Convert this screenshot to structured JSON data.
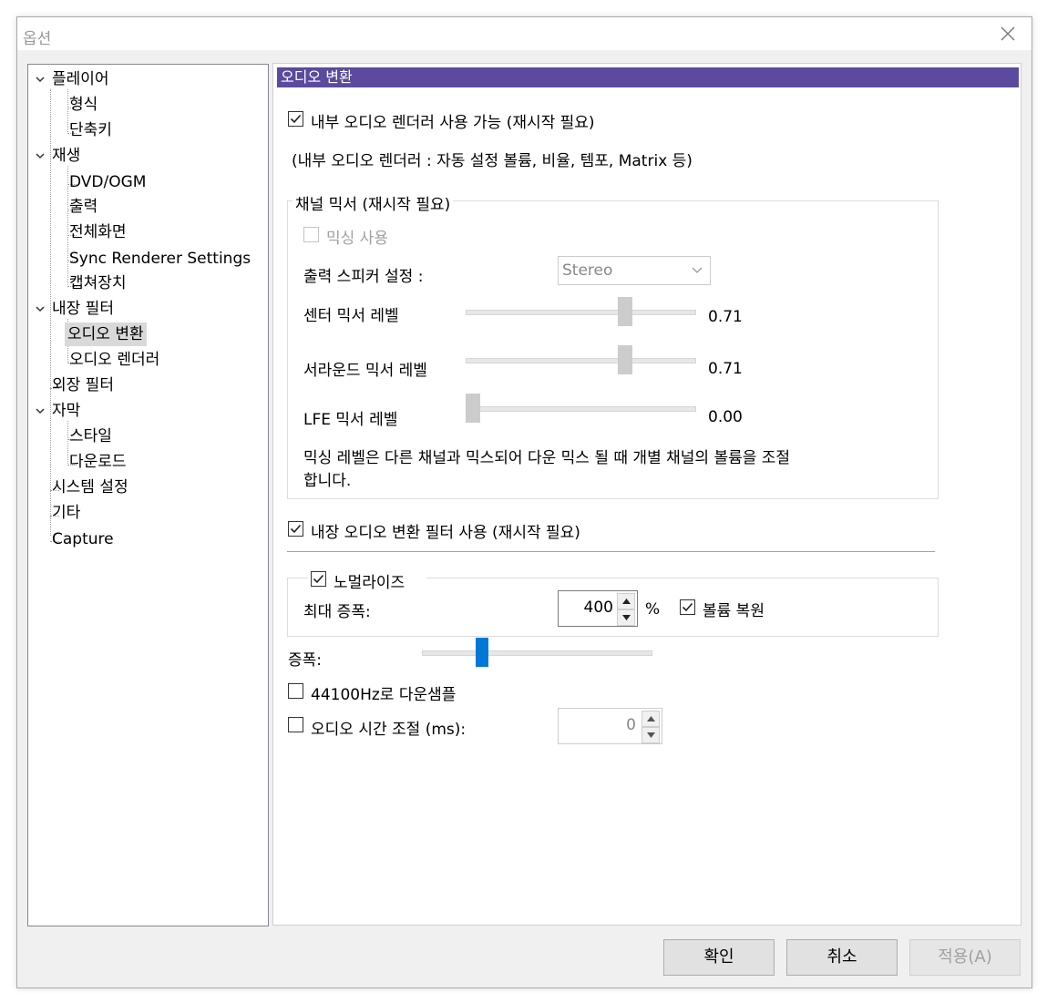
{
  "window": {
    "title": "옵션"
  },
  "tree": {
    "items": [
      {
        "label": "플레이어"
      },
      {
        "label": "형식"
      },
      {
        "label": "단축키"
      },
      {
        "label": "재생"
      },
      {
        "label": "DVD/OGM"
      },
      {
        "label": "출력"
      },
      {
        "label": "전체화면"
      },
      {
        "label": "Sync Renderer Settings"
      },
      {
        "label": "캡쳐장치"
      },
      {
        "label": "내장 필터"
      },
      {
        "label": "오디오 변환"
      },
      {
        "label": "오디오 렌더러"
      },
      {
        "label": "외장 필터"
      },
      {
        "label": "자막"
      },
      {
        "label": "스타일"
      },
      {
        "label": "다운로드"
      },
      {
        "label": "시스템 설정"
      },
      {
        "label": "기타"
      },
      {
        "label": "Capture"
      }
    ],
    "selected": "오디오 변환"
  },
  "panel": {
    "header": "오디오 변환",
    "internal_renderer": {
      "label": "내부 오디오 렌더러 사용 가능 (재시작 필요)",
      "checked": true
    },
    "internal_renderer_note": "(내부 오디오 렌더러 : 자동 설정 볼륨, 비율, 템포, Matrix 등)",
    "channel_mixer": {
      "title": "채널 믹서 (재시작 필요)",
      "enable_mixing": {
        "label": "믹싱 사용",
        "checked": false,
        "disabled": true
      },
      "speaker_label": "출력 스피커 설정 :",
      "speaker_value": "Stereo",
      "center_label": "센터 믹서 레벨",
      "center_value": "0.71",
      "center_level": 0.71,
      "surround_label": "서라운드 믹서 레벨",
      "surround_value": "0.71",
      "surround_level": 0.71,
      "lfe_label": "LFE 믹서 레벨",
      "lfe_value": "0.00",
      "lfe_level": 0.0,
      "note_line1": "믹싱 레벨은 다른 채널과 믹스되어 다운 믹스 될 때 개별 채널의 볼륨을 조절",
      "note_line2": "합니다."
    },
    "builtin_filter": {
      "label": "내장 오디오 변환 필터 사용 (재시작 필요)",
      "checked": true
    },
    "normalize": {
      "label": "노멀라이즈",
      "checked": true,
      "max_amp_label": "최대 증폭:",
      "max_amp_value": "400",
      "unit": "%",
      "restore_volume": {
        "label": "볼륨 복원",
        "checked": true
      }
    },
    "amplify": {
      "label": "증폭:"
    },
    "downsample": {
      "label": "44100Hz로 다운샘플",
      "checked": false
    },
    "audio_delay": {
      "label": "오디오 시간 조절 (ms):",
      "checked": false,
      "value": "0"
    }
  },
  "buttons": {
    "ok": "확인",
    "cancel": "취소",
    "apply": "적용(A)"
  },
  "colors": {
    "header_bg": "#5b4a9e",
    "slider_accent": "#0078d7"
  }
}
